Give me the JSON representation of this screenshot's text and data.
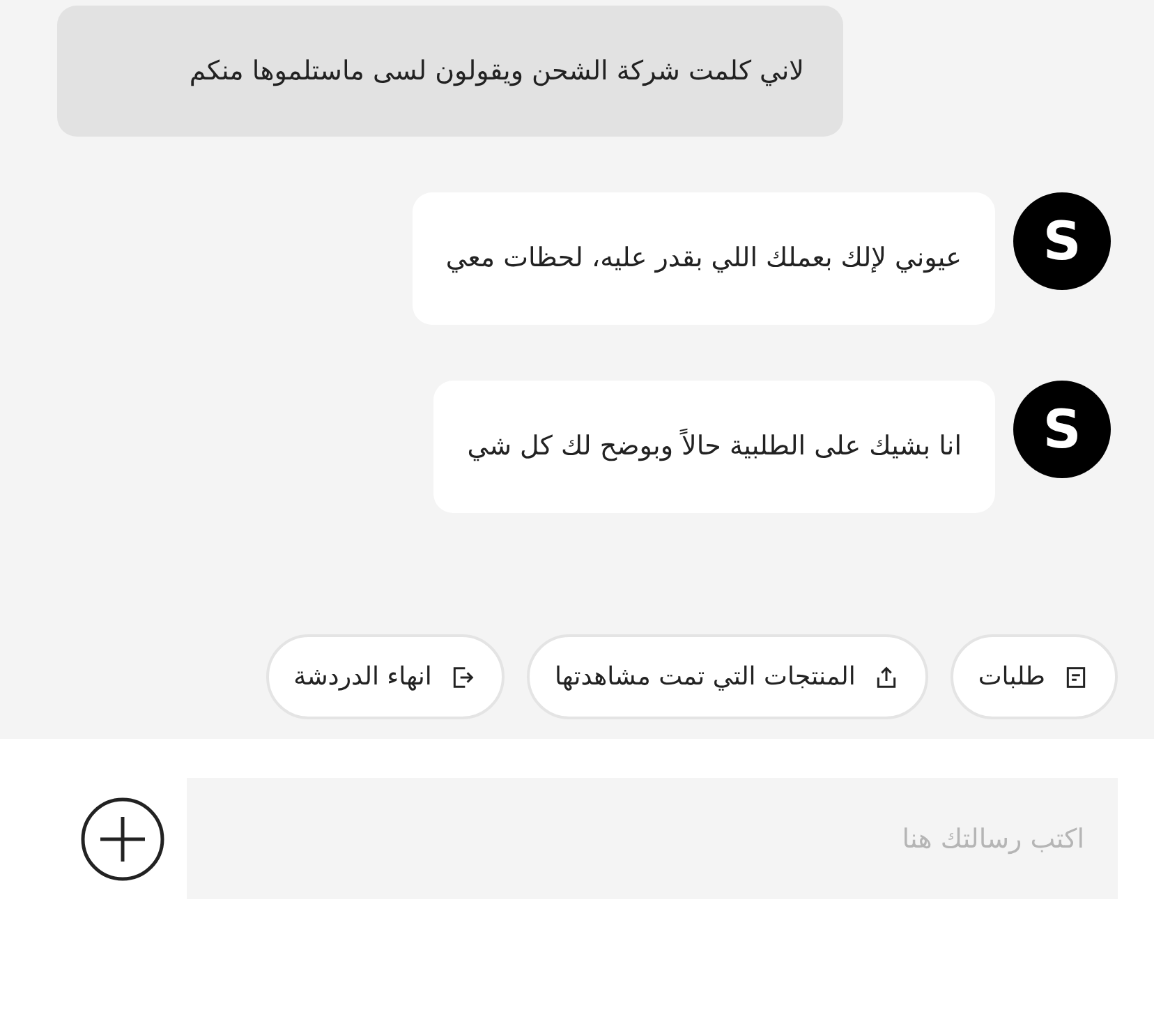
{
  "messages": [
    {
      "kind": "user",
      "text": "لاني كلمت شركة الشحن ويقولون لسى ماستلموها منكم"
    },
    {
      "kind": "agent",
      "avatar": "S",
      "text": "عيوني لإلك بعملك اللي بقدر عليه، لحظات معي"
    },
    {
      "kind": "agent",
      "avatar": "S",
      "text": "انا بشيك على الطلبية حالاً وبوضح لك كل شي"
    }
  ],
  "quick_replies": [
    {
      "kind": "orders",
      "label": "طلبات"
    },
    {
      "kind": "viewed",
      "label": "المنتجات التي تمت مشاهدتها"
    },
    {
      "kind": "end",
      "label": "انهاء الدردشة"
    }
  ],
  "composer": {
    "placeholder": "اكتب رسالتك هنا"
  }
}
